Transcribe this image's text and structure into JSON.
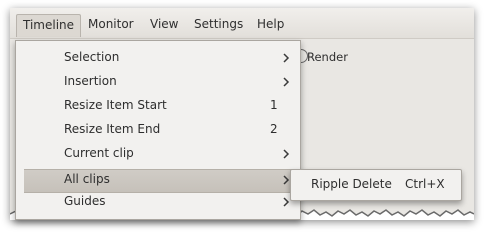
{
  "menubar": {
    "items": [
      {
        "label": "Timeline"
      },
      {
        "label": "Monitor"
      },
      {
        "label": "View"
      },
      {
        "label": "Settings"
      },
      {
        "label": "Help"
      }
    ]
  },
  "toolbar": {
    "render_label": "Render"
  },
  "timeline_menu": {
    "items": [
      {
        "label": "Selection",
        "shortcut": "",
        "has_submenu": true
      },
      {
        "label": "Insertion",
        "shortcut": "",
        "has_submenu": true
      },
      {
        "label": "Resize Item Start",
        "shortcut": "1",
        "has_submenu": false
      },
      {
        "label": "Resize Item End",
        "shortcut": "2",
        "has_submenu": false
      },
      {
        "label": "Current clip",
        "shortcut": "",
        "has_submenu": true
      },
      {
        "label": "All clips",
        "shortcut": "",
        "has_submenu": true,
        "highlighted": true
      },
      {
        "label": "Guides",
        "shortcut": "",
        "has_submenu": true
      }
    ]
  },
  "all_clips_submenu": {
    "items": [
      {
        "label": "Ripple Delete",
        "shortcut": "Ctrl+X"
      }
    ]
  },
  "colors": {
    "window_bg": "#e9e7e3",
    "menu_bg": "#f2f1ef",
    "highlight_bg": "#c9c4bd"
  }
}
